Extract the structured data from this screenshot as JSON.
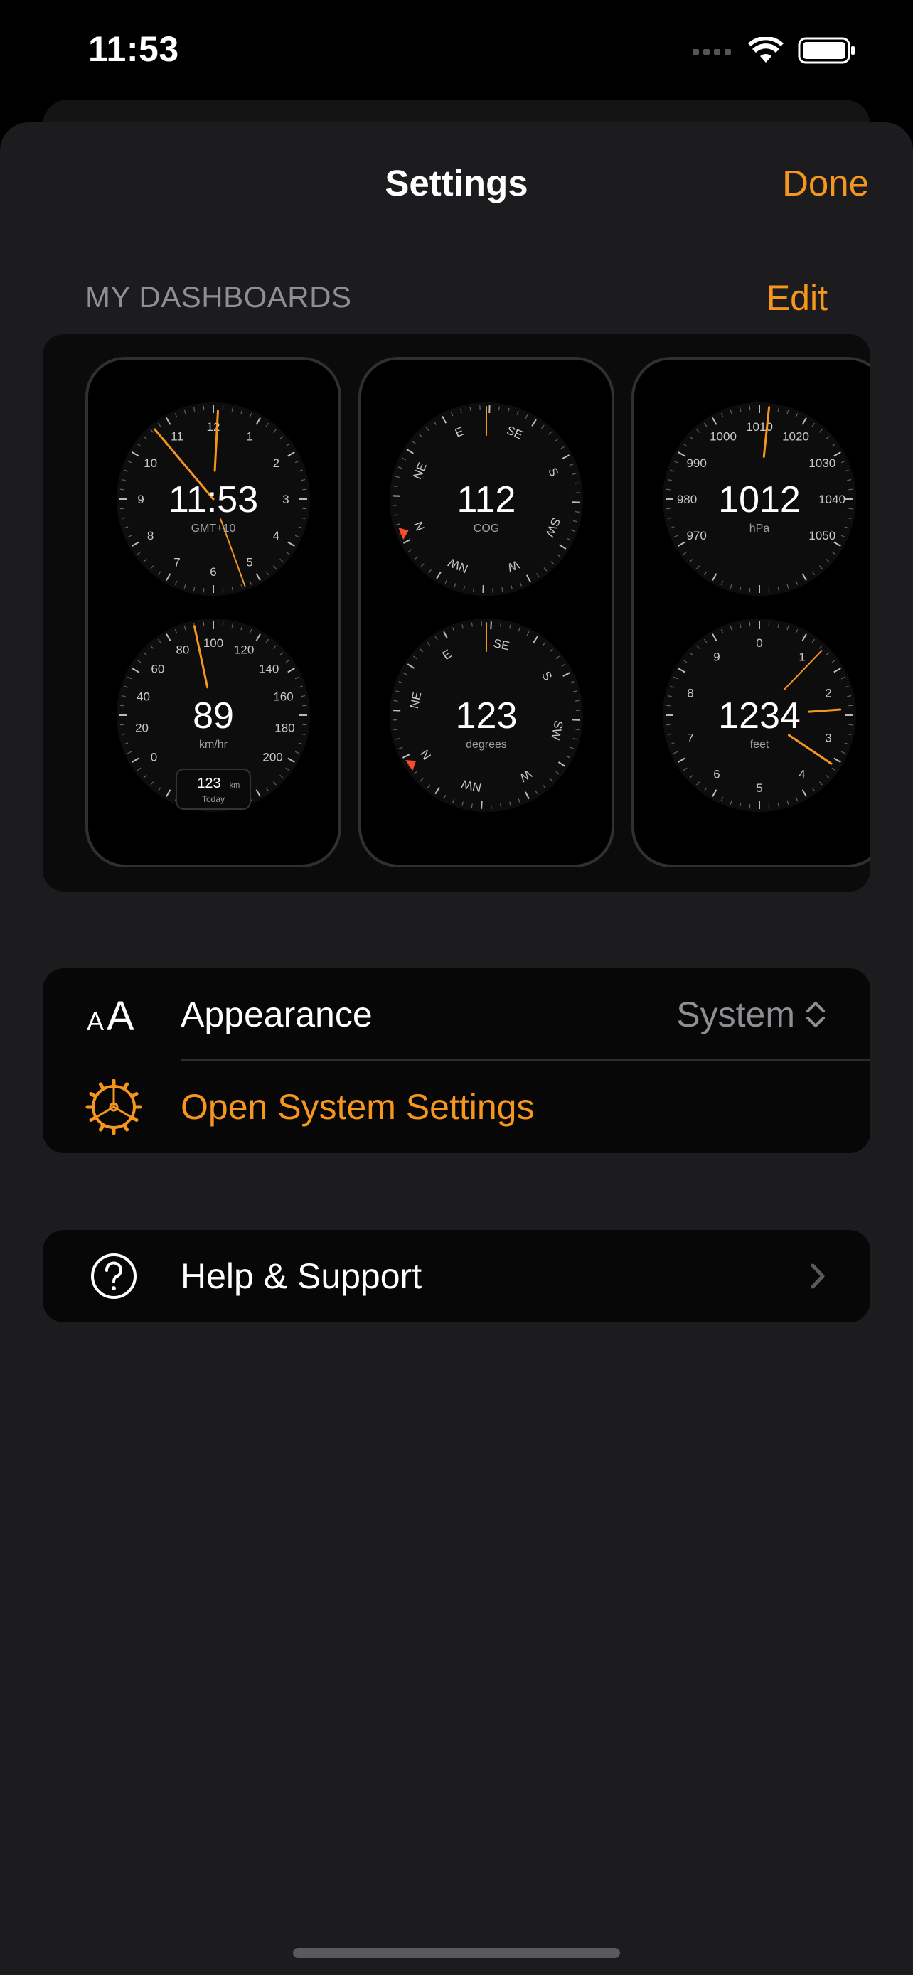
{
  "status": {
    "time": "11:53"
  },
  "nav": {
    "title": "Settings",
    "done_label": "Done"
  },
  "dashboards": {
    "header": "MY DASHBOARDS",
    "edit_label": "Edit",
    "cards": [
      {
        "top": {
          "value": "11:53",
          "unit": "GMT+10",
          "labels": [
            "12",
            "1",
            "2",
            "3",
            "4",
            "5",
            "6",
            "7",
            "8",
            "9",
            "10",
            "11"
          ]
        },
        "bottom": {
          "value": "89",
          "unit": "km/hr",
          "labels": [
            "0",
            "20",
            "40",
            "60",
            "80",
            "100",
            "120",
            "140",
            "160",
            "180",
            "200"
          ],
          "box_value": "123",
          "box_unit": "km",
          "box_caption": "Today"
        }
      },
      {
        "top": {
          "value": "112",
          "unit": "COG",
          "labels": [
            "E",
            "SE",
            "S",
            "SW",
            "W",
            "NW",
            "N",
            "NE"
          ]
        },
        "bottom": {
          "value": "123",
          "unit": "degrees",
          "labels": [
            "E",
            "SE",
            "S",
            "SW",
            "W",
            "NW",
            "N",
            "NE"
          ]
        }
      },
      {
        "top": {
          "value": "1012",
          "unit": "hPa",
          "labels": [
            "970",
            "980",
            "990",
            "1000",
            "1010",
            "1020",
            "1030",
            "1040",
            "1050"
          ]
        },
        "bottom": {
          "value": "1234",
          "unit": "feet",
          "labels": [
            "0",
            "1",
            "2",
            "3",
            "4",
            "5",
            "6",
            "7",
            "8",
            "9"
          ]
        }
      }
    ]
  },
  "settings_group": {
    "appearance_label": "Appearance",
    "appearance_value": "System",
    "open_system_settings_label": "Open System Settings"
  },
  "support_group": {
    "help_label": "Help & Support"
  },
  "colors": {
    "accent": "#f7961d",
    "needle_red": "#ff4a2a",
    "background": "#1c1c1e"
  },
  "icons": [
    "text-size-icon",
    "gear-icon",
    "question-circle-icon",
    "chevron-right-icon",
    "chevron-up-down-icon",
    "wifi-icon",
    "battery-icon",
    "signal-icon"
  ]
}
